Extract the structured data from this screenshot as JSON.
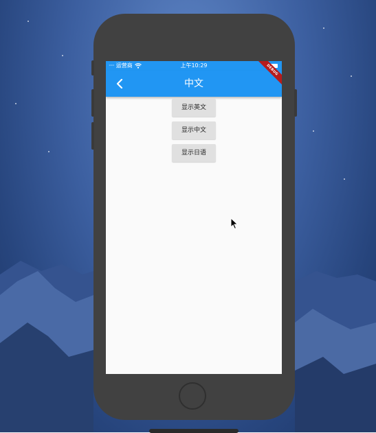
{
  "status_bar": {
    "signal": "·····",
    "carrier": "运营商",
    "time": "上午10:29"
  },
  "app_bar": {
    "title": "中文",
    "debug_banner": "DEBUG"
  },
  "buttons": [
    {
      "label": "显示英文"
    },
    {
      "label": "显示中文"
    },
    {
      "label": "显示日语"
    }
  ],
  "colors": {
    "app_bar": "#2196f3",
    "screen_background": "#fafafa",
    "button_background": "#e0e0e0",
    "phone_frame": "#414141",
    "debug_ribbon": "#b71c1c"
  },
  "icons": {
    "back": "chevron-left-icon",
    "wifi": "wifi-icon",
    "battery": "battery-icon",
    "cursor": "mouse-pointer-icon"
  }
}
